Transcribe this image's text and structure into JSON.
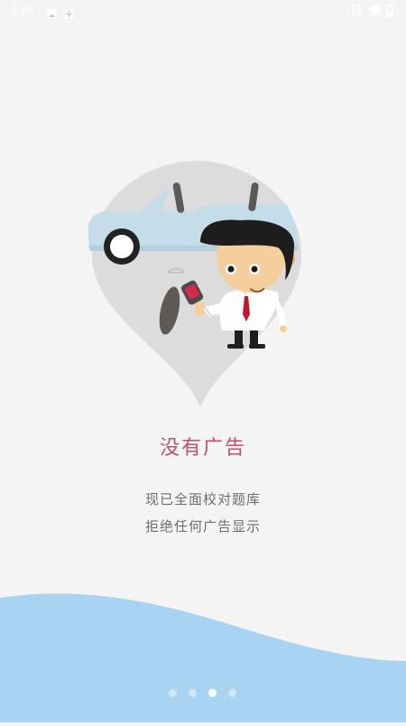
{
  "status_bar": {
    "time": "3:56",
    "left_icons": [
      "gallery-icon",
      "notification-plus-icon"
    ],
    "right_icons": [
      "vibrate-off-icon",
      "wifi-icon",
      "battery-icon"
    ]
  },
  "slide": {
    "headline": "没有广告",
    "lines": [
      "现已全面校对题库",
      "拒绝任何广告显示"
    ],
    "illustration": "man-with-car-key-illustration"
  },
  "pager": {
    "total": 4,
    "active_index": 2
  },
  "colors": {
    "background": "#f4f4f4",
    "headline": "#c0506a",
    "subtext": "#6e6e6e",
    "wave": "#a8d4f2",
    "dot_inactive": "#cfe6f6",
    "dot_active": "#ffffff"
  }
}
